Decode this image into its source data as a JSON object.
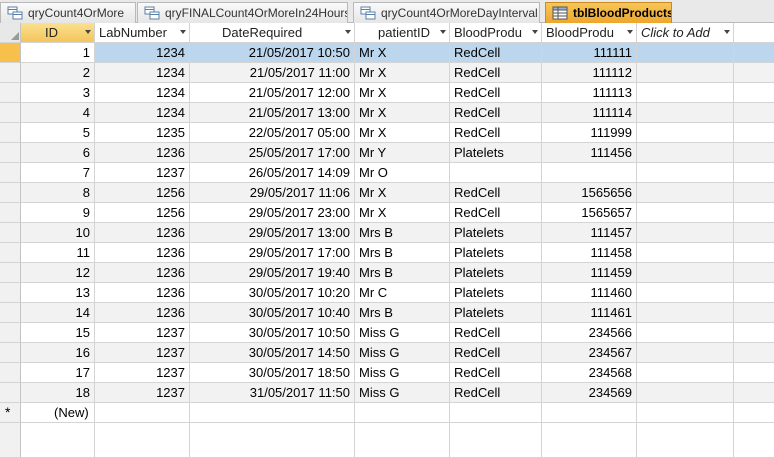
{
  "tabs": [
    {
      "label": "qryCount4OrMore",
      "active": false
    },
    {
      "label": "qryFINALCount4OrMoreIn24Hours",
      "active": false
    },
    {
      "label": "qryCount4OrMoreDayInterval",
      "active": false
    },
    {
      "label": "tblBloodProducts",
      "active": true
    }
  ],
  "columns": [
    {
      "label": "ID"
    },
    {
      "label": "LabNumber"
    },
    {
      "label": "DateRequired"
    },
    {
      "label": "patientID"
    },
    {
      "label": "BloodProdu"
    },
    {
      "label": "BloodProdu"
    },
    {
      "label": "Click to Add"
    }
  ],
  "rows": [
    [
      "1",
      "1234",
      "21/05/2017 10:50",
      "Mr X",
      "RedCell",
      "111111"
    ],
    [
      "2",
      "1234",
      "21/05/2017 11:00",
      "Mr X",
      "RedCell",
      "111112"
    ],
    [
      "3",
      "1234",
      "21/05/2017 12:00",
      "Mr X",
      "RedCell",
      "111113"
    ],
    [
      "4",
      "1234",
      "21/05/2017 13:00",
      "Mr X",
      "RedCell",
      "111114"
    ],
    [
      "5",
      "1235",
      "22/05/2017 05:00",
      "Mr X",
      "RedCell",
      "111999"
    ],
    [
      "6",
      "1236",
      "25/05/2017 17:00",
      "Mr Y",
      "Platelets",
      "111456"
    ],
    [
      "7",
      "1237",
      "26/05/2017 14:09",
      "Mr O",
      "",
      ""
    ],
    [
      "8",
      "1256",
      "29/05/2017 11:06",
      "Mr X",
      "RedCell",
      "1565656"
    ],
    [
      "9",
      "1256",
      "29/05/2017 23:00",
      "Mr X",
      "RedCell",
      "1565657"
    ],
    [
      "10",
      "1236",
      "29/05/2017 13:00",
      "Mrs B",
      "Platelets",
      "111457"
    ],
    [
      "11",
      "1236",
      "29/05/2017 17:00",
      "Mrs B",
      "Platelets",
      "111458"
    ],
    [
      "12",
      "1236",
      "29/05/2017 19:40",
      "Mrs B",
      "Platelets",
      "111459"
    ],
    [
      "13",
      "1236",
      "30/05/2017 10:20",
      "Mr C",
      "Platelets",
      "111460"
    ],
    [
      "14",
      "1236",
      "30/05/2017 10:40",
      "Mrs B",
      "Platelets",
      "111461"
    ],
    [
      "15",
      "1237",
      "30/05/2017 10:50",
      "Miss G",
      "RedCell",
      "234566"
    ],
    [
      "16",
      "1237",
      "30/05/2017 14:50",
      "Miss G",
      "RedCell",
      "234567"
    ],
    [
      "17",
      "1237",
      "30/05/2017 18:50",
      "Miss G",
      "RedCell",
      "234568"
    ],
    [
      "18",
      "1237",
      "31/05/2017 11:50",
      "Miss G",
      "RedCell",
      "234569"
    ]
  ],
  "new_row": {
    "id_label": "(New)",
    "marker": "*"
  },
  "selected_row_index": 0,
  "colors": {
    "active_tab": "#f0ab32",
    "selected_row": "#bcd6ee",
    "alt_row": "#f2f2f2",
    "grid_line": "#d4d4d4"
  }
}
